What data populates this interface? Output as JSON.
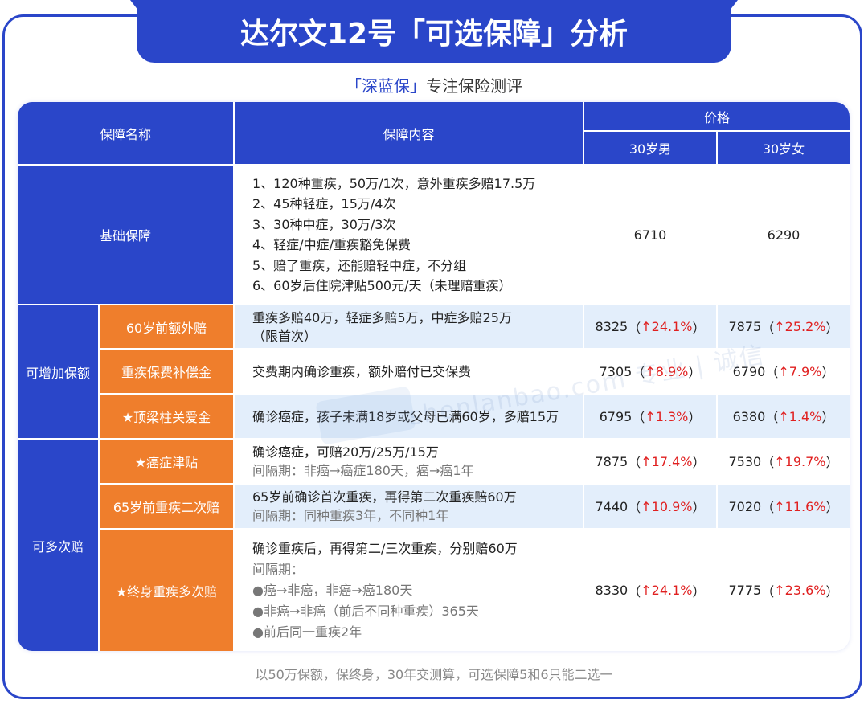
{
  "title": "达尔文12号「可选保障」分析",
  "subtitle": {
    "brand": "「深蓝保」",
    "text": "专注保险测评"
  },
  "header": {
    "name": "保障名称",
    "content": "保障内容",
    "price": "价格",
    "male": "30岁男",
    "female": "30岁女"
  },
  "groups": {
    "basic": "基础保障",
    "addable": "可增加保额",
    "multi": "可多次赔"
  },
  "basic": {
    "lines": [
      "1、120种重疾，50万/1次，意外重疾多赔17.5万",
      "2、45种轻症，15万/4次",
      "3、30种中症，30万/3次",
      "4、轻症/中症/重疾豁免保费",
      "5、赔了重疾，还能赔轻中症，不分组",
      "6、60岁后住院津贴500元/天（未理赔重疾）"
    ],
    "male": "6710",
    "female": "6290"
  },
  "rows": [
    {
      "name": "60岁前额外赔",
      "lines": [
        "重疾多赔40万，轻症多赔5万，中症多赔25万",
        "（限首次）"
      ],
      "gray": [],
      "male_price": "8325",
      "male_pct": "24.1%",
      "female_price": "7875",
      "female_pct": "25.2%"
    },
    {
      "name": "重疾保费补偿金",
      "lines": [
        "交费期内确诊重疾，额外赔付已交保费"
      ],
      "gray": [],
      "male_price": "7305",
      "male_pct": "8.9%",
      "female_price": "6790",
      "female_pct": "7.9%"
    },
    {
      "name": "★顶梁柱关爱金",
      "lines": [
        "确诊癌症，孩子未满18岁或父母已满60岁，多赔15万"
      ],
      "gray": [],
      "male_price": "6795",
      "male_pct": "1.3%",
      "female_price": "6380",
      "female_pct": "1.4%"
    },
    {
      "name": "★癌症津贴",
      "lines": [
        "确诊癌症，可赔20万/25万/15万"
      ],
      "gray": [
        "间隔期：非癌→癌症180天，癌→癌1年"
      ],
      "male_price": "7875",
      "male_pct": "17.4%",
      "female_price": "7530",
      "female_pct": "19.7%"
    },
    {
      "name": "65岁前重疾二次赔",
      "lines": [
        "65岁前确诊首次重疾，再得第二次重疾赔60万"
      ],
      "gray": [
        "间隔期：同种重疾3年，不同种1年"
      ],
      "male_price": "7440",
      "male_pct": "10.9%",
      "female_price": "7020",
      "female_pct": "11.6%"
    },
    {
      "name": "★终身重疾多次赔",
      "lines": [
        "确诊重疾后，再得第二/三次重疾，分别赔60万"
      ],
      "gray": [
        "间隔期：",
        "●癌→非癌，非癌→癌180天",
        "●非癌→非癌（前后不同种重疾）365天",
        "●前后同一重疾2年"
      ],
      "male_price": "8330",
      "male_pct": "24.1%",
      "female_price": "7775",
      "female_pct": "23.6%"
    }
  ],
  "open_paren": "（",
  "close_paren": "）",
  "up_arrow": "↑",
  "watermark": "shenlanbao.com 专业 | 诚信",
  "footer": "以50万保额，保终身，30年交测算，可选保障5和6只能二选一",
  "colors": {
    "blue": "#2a46c9",
    "orange": "#ef7e2c",
    "light": "#e3eefb",
    "up": "#e02020"
  }
}
